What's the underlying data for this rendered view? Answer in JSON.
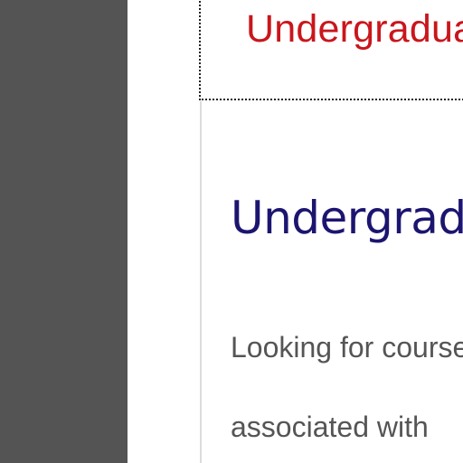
{
  "navigation": {
    "focused_item_label": "Undergraduate"
  },
  "main": {
    "title": "Undergraduate",
    "intro_lines": [
      "Looking for courses",
      "associated with"
    ]
  }
}
